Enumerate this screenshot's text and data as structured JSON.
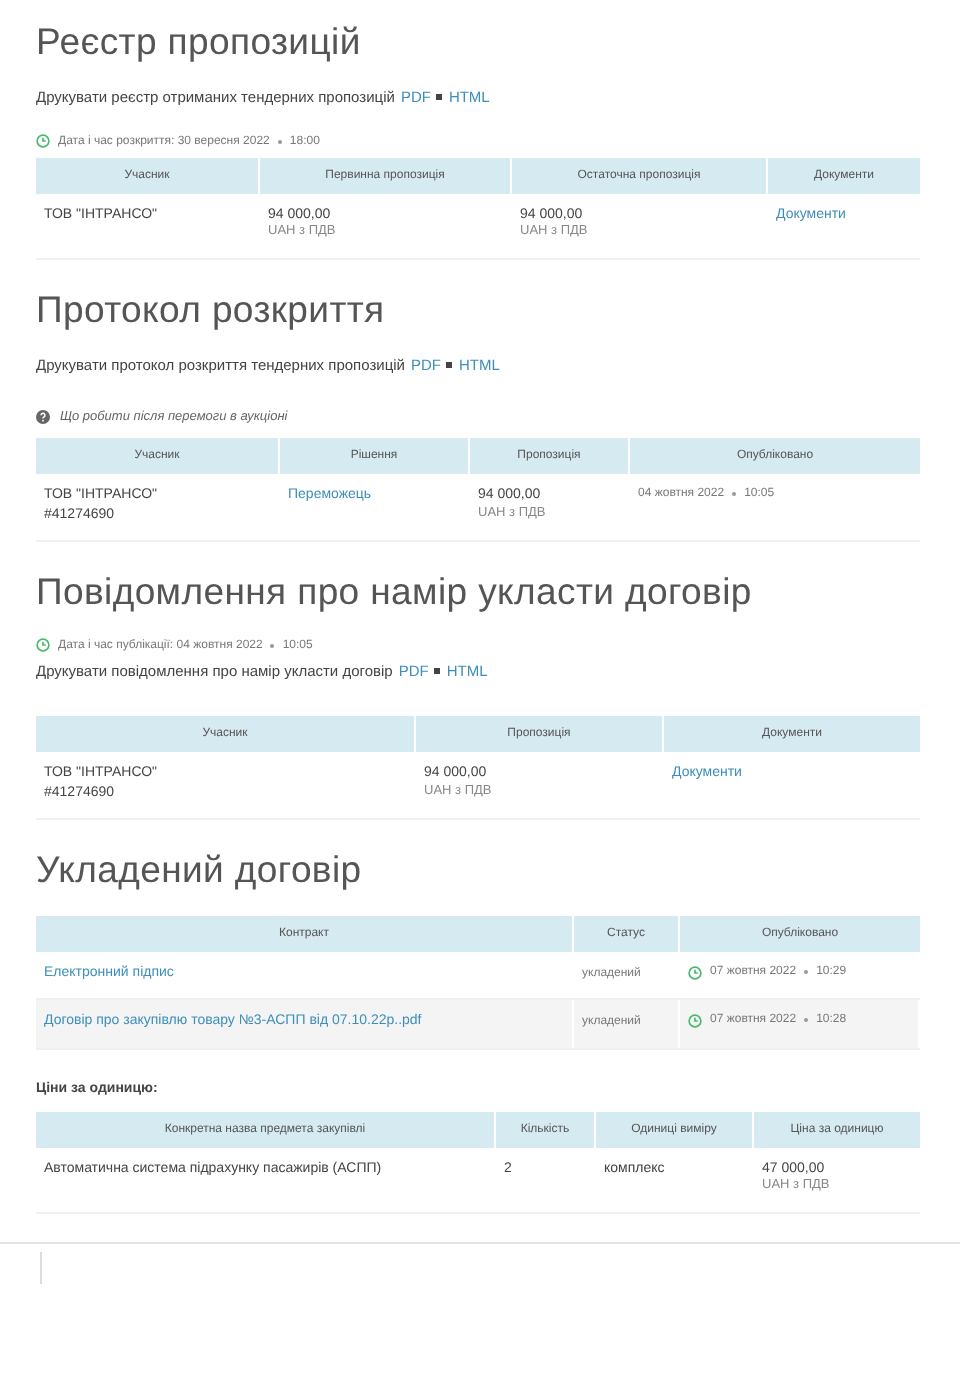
{
  "sections": [
    {
      "title": "Реєстр пропозицій",
      "blocks": [
        {
          "kind": "print",
          "label": "Друкувати реєстр отриманих тендерних пропозицій",
          "pdf": "PDF",
          "html": "HTML"
        },
        {
          "kind": "date",
          "label": "Дата і час розкриття: 30 вересня 2022",
          "time": "18:00"
        },
        {
          "kind": "table",
          "columns": [
            "Учасник",
            "Первинна пропозиція",
            "Остаточна пропозиція",
            "Документи"
          ],
          "rows": [
            {
              "cells": [
                {
                  "kind": "text",
                  "text": "ТОВ \"ІНТРАНСО\""
                },
                {
                  "kind": "money",
                  "text": "94 000,00",
                  "sub": "UAH з ПДВ"
                },
                {
                  "kind": "money",
                  "text": "94 000,00",
                  "sub": "UAH з ПДВ"
                },
                {
                  "kind": "link",
                  "text": "Документи"
                }
              ]
            }
          ]
        }
      ]
    },
    {
      "title": "Протокол розкриття",
      "blocks": [
        {
          "kind": "print",
          "label": "Друкувати протокол розкриття тендерних пропозицій",
          "pdf": "PDF",
          "html": "HTML"
        },
        {
          "kind": "help",
          "text": "Що робити після перемоги в аукціоні"
        },
        {
          "kind": "table",
          "columns": [
            "Учасник",
            "Рішення",
            "Пропозиція",
            "Опубліковано"
          ],
          "rows": [
            {
              "cells": [
                {
                  "kind": "text",
                  "text": "ТОВ \"ІНТРАНСО\"",
                  "sub": "#41274690"
                },
                {
                  "kind": "link",
                  "text": "Переможець"
                },
                {
                  "kind": "money",
                  "text": "94 000,00",
                  "sub": "UAH з ПДВ"
                },
                {
                  "kind": "date",
                  "text": "04 жовтня 2022",
                  "time": "10:05"
                }
              ]
            }
          ]
        }
      ]
    },
    {
      "title": "Повідомлення про намір укласти договір",
      "blocks": [
        {
          "kind": "date",
          "label": "Дата і час публікації: 04 жовтня 2022",
          "time": "10:05"
        },
        {
          "kind": "print",
          "label": "Друкувати повідомлення про намір укласти договір",
          "pdf": "PDF",
          "html": "HTML"
        },
        {
          "kind": "table",
          "columns": [
            "Учасник",
            "Пропозиція",
            "Документи"
          ],
          "rows": [
            {
              "cells": [
                {
                  "kind": "text",
                  "text": "ТОВ \"ІНТРАНСО\"",
                  "sub": "#41274690"
                },
                {
                  "kind": "money",
                  "text": "94 000,00",
                  "sub": "UAH з ПДВ"
                },
                {
                  "kind": "link",
                  "text": "Документи"
                }
              ]
            }
          ]
        }
      ]
    },
    {
      "title": "Укладений договір",
      "blocks": [
        {
          "kind": "table",
          "columns": [
            "Контракт",
            "Статус",
            "Опубліковано"
          ],
          "rows": [
            {
              "cells": [
                {
                  "kind": "link",
                  "text": "Електронний підпис"
                },
                {
                  "kind": "status",
                  "text": "укладений"
                },
                {
                  "kind": "clock_date",
                  "text": "07 жовтня 2022",
                  "time": "10:29"
                }
              ]
            },
            {
              "cells": [
                {
                  "kind": "link",
                  "text": "Договір про закупівлю товару №3-АСПП від 07.10.22р..pdf"
                },
                {
                  "kind": "status",
                  "text": "укладений"
                },
                {
                  "kind": "clock_date",
                  "text": "07 жовтня 2022",
                  "time": "10:28"
                }
              ]
            }
          ]
        },
        {
          "kind": "subheading",
          "text": "Ціни за одиницю:"
        },
        {
          "kind": "table",
          "columns": [
            "Конкретна назва предмета закупівлі",
            "Кількість",
            "Одиниці виміру",
            "Ціна за одиницю"
          ],
          "rows": [
            {
              "cells": [
                {
                  "kind": "text",
                  "text": "Автоматична система підрахунку пасажирів (АСПП)"
                },
                {
                  "kind": "text",
                  "text": "2"
                },
                {
                  "kind": "text",
                  "text": "комплекс"
                },
                {
                  "kind": "money",
                  "text": "47 000,00",
                  "sub": "UAH з ПДВ"
                }
              ]
            }
          ]
        }
      ]
    }
  ]
}
